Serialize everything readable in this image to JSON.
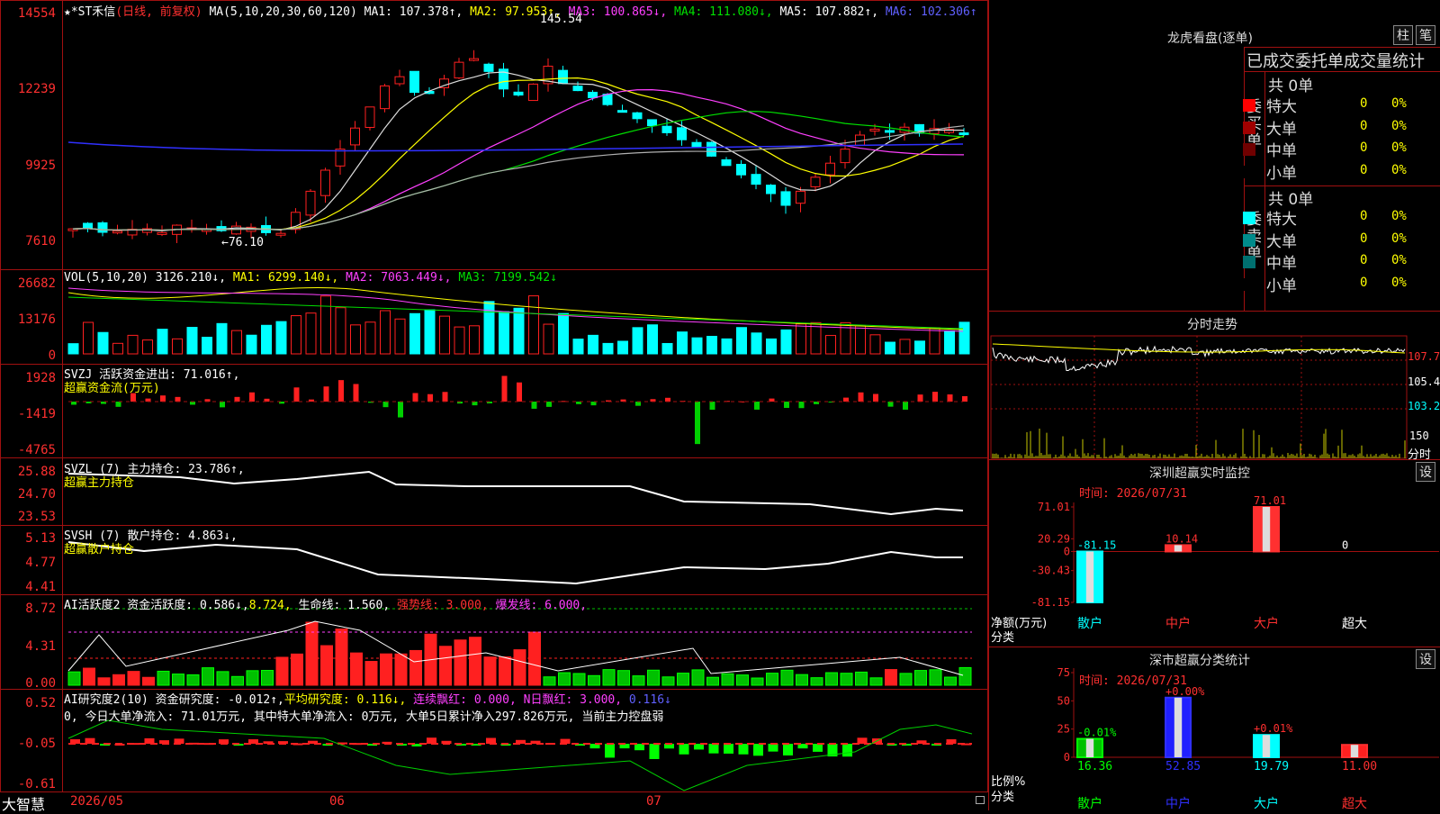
{
  "app": {
    "brand": "大智慧",
    "colors": {
      "up": "#ff2020",
      "down": "#00ffff",
      "border": "#a01010"
    }
  },
  "kline": {
    "title_prefix": "★*ST禾信",
    "title_mode": "(日线, 前复权)",
    "ma_label": "MA(5,10,20,30,60,120)",
    "ma1": "MA1: 107.378↑,",
    "ma2": "MA2: 97.953↑,",
    "ma3": "MA3: 100.865↓,",
    "ma4": "MA4: 111.080↓,",
    "ma5": "MA5: 107.882↑,",
    "ma6": "MA6: 102.306↑",
    "high_label": "145.54",
    "low_label": "←76.10",
    "yticks": [
      "14554",
      "12239",
      "9925",
      "7610"
    ]
  },
  "vol": {
    "label": "VOL(5,10,20)",
    "value": "3126.210↓,",
    "ma1": "MA1: 6299.140↓,",
    "ma2": "MA2: 7063.449↓,",
    "ma3": "MA3: 7199.542↓",
    "yticks": [
      "26682",
      "13176",
      "0"
    ]
  },
  "svzj": {
    "label": "SVZJ  活跃资金进出: 71.016↑,",
    "sub": "超赢资金流(万元)",
    "yticks": [
      "1928",
      "-1419",
      "-4765"
    ]
  },
  "svzl": {
    "label": "SVZL (7) 主力持仓: 23.786↑,",
    "sub": "超赢主力持仓",
    "yticks": [
      "25.88",
      "24.70",
      "23.53"
    ]
  },
  "svsh": {
    "label": "SVSH (7) 散户持仓: 4.863↓,",
    "sub": "超赢散户持仓",
    "yticks": [
      "5.13",
      "4.77",
      "4.41"
    ]
  },
  "ai1": {
    "label": "AI活跃度2 资金活跃度: 0.586↓,",
    "v2": "8.724,",
    "life": "生命线: 1.560,",
    "strong": "强势线: 3.000,",
    "burst": "爆发线: 6.000,",
    "yticks": [
      "8.72",
      "4.31",
      "0.00"
    ]
  },
  "ai2": {
    "label": "AI研究度2(10) 资金研究度: -0.012↑,",
    "avg": "平均研究度: 0.116↓,",
    "red": "连续飘红: 0.000,",
    "nred": "N日飘红: 3.000,",
    "tail": "0.116↓",
    "note": "0, 今日大单净流入: 71.01万元, 其中特大单净流入: 0万元, 大单5日累计净入297.826万元, 当前主力控盘弱",
    "yticks": [
      "0.52",
      "-0.05",
      "-0.61"
    ]
  },
  "xaxis": {
    "labels": [
      "2026/05",
      "06",
      "07"
    ]
  },
  "longhu": {
    "title": "龙虎看盘(逐单)",
    "btn1": "柱",
    "btn2": "笔",
    "header": "已成交委托单成交量统计",
    "buy_label": "委买单",
    "sell_label": "委卖单",
    "buy_total": "共 0单",
    "sell_total": "共 0单",
    "buy_rows": [
      {
        "name": "特大",
        "num": "0",
        "pct": "0%",
        "color": "#ff0000"
      },
      {
        "name": "大单",
        "num": "0",
        "pct": "0%",
        "color": "#a00000"
      },
      {
        "name": "中单",
        "num": "0",
        "pct": "0%",
        "color": "#700000"
      },
      {
        "name": "小单",
        "num": "0",
        "pct": "0%",
        "color": "#000000"
      }
    ],
    "sell_rows": [
      {
        "name": "特大",
        "num": "0",
        "pct": "0%",
        "color": "#00ffff"
      },
      {
        "name": "大单",
        "num": "0",
        "pct": "0%",
        "color": "#008b8b"
      },
      {
        "name": "中单",
        "num": "0",
        "pct": "0%",
        "color": "#007070"
      },
      {
        "name": "小单",
        "num": "0",
        "pct": "0%",
        "color": "#000000"
      }
    ]
  },
  "fenshi": {
    "title": "分时走势",
    "yticks": [
      "107.7",
      "105.4",
      "103.2"
    ],
    "vol_tick": "150",
    "unit": "分时"
  },
  "szmon": {
    "title": "深圳超赢实时监控",
    "btn": "设",
    "time": "时间: 2026/07/31",
    "yticks": [
      "71.01",
      "20.29",
      "0",
      "-30.43",
      "-81.15"
    ],
    "ylabel": "净额(万元)",
    "xlabel": "分类",
    "categories": [
      "散户",
      "中户",
      "大户",
      "超大"
    ],
    "values": [
      -81.15,
      10.14,
      71.01,
      0
    ],
    "value_labels": [
      "-81.15",
      "10.14",
      "71.01",
      "0"
    ]
  },
  "szcls": {
    "title": "深市超赢分类统计",
    "btn": "设",
    "time": "时间: 2026/07/31",
    "yticks": [
      "75",
      "50",
      "25",
      "0"
    ],
    "ylabel": "比例%",
    "xlabel": "分类",
    "categories": [
      "散户",
      "中户",
      "大户",
      "超大"
    ],
    "values": [
      16.36,
      52.85,
      19.79,
      11.0
    ],
    "value_labels": [
      "16.36",
      "52.85",
      "19.79",
      "11.00"
    ],
    "change_labels": [
      "-0.01%",
      "+0.00%",
      "+0.01%",
      ""
    ]
  },
  "chart_data": [
    {
      "type": "bar",
      "title": "深圳超赢实时监控",
      "categories": [
        "散户",
        "中户",
        "大户",
        "超大"
      ],
      "values": [
        -81.15,
        10.14,
        71.01,
        0
      ],
      "ylabel": "净额(万元)",
      "xlabel": "分类",
      "ylim": [
        -81.15,
        71.01
      ]
    },
    {
      "type": "bar",
      "title": "深市超赢分类统计",
      "categories": [
        "散户",
        "中户",
        "大户",
        "超大"
      ],
      "values": [
        16.36,
        52.85,
        19.79,
        11.0
      ],
      "ylabel": "比例%",
      "xlabel": "分类",
      "ylim": [
        0,
        75
      ]
    }
  ]
}
